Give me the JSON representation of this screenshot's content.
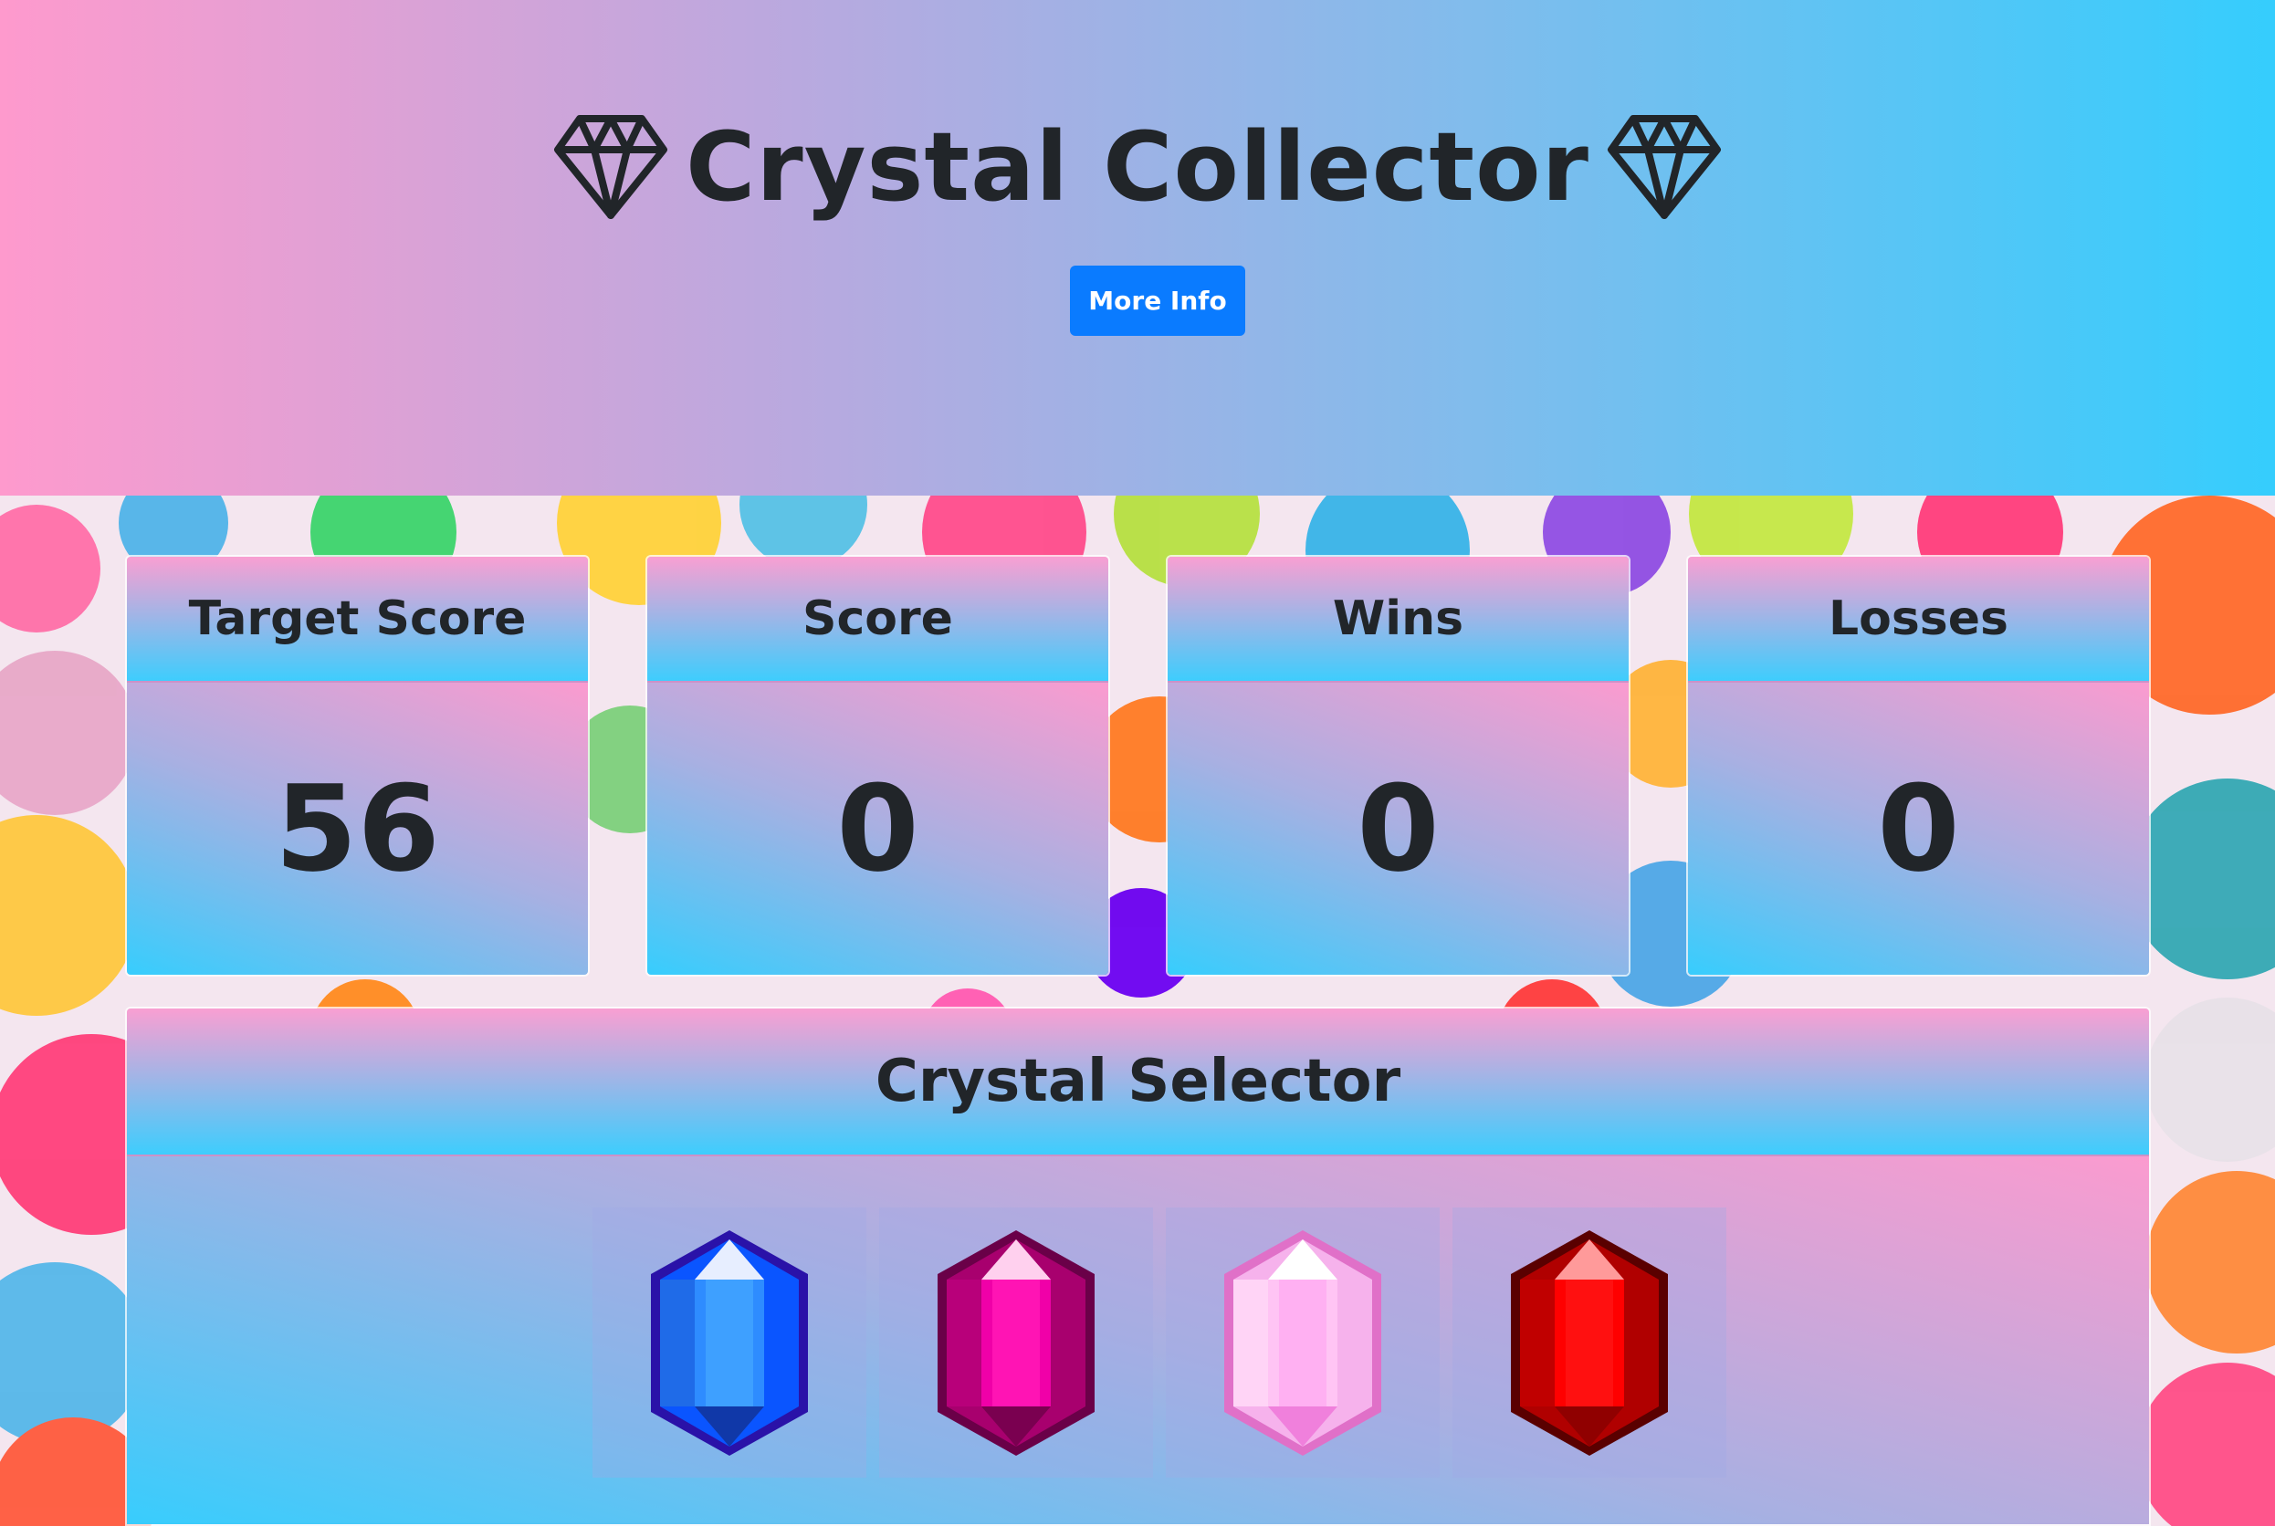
{
  "header": {
    "title": "Crystal Collector",
    "left_icon": "diamond-icon",
    "right_icon": "diamond-icon",
    "more_info_label": "More Info",
    "button_color": "#0a7bff"
  },
  "stats": {
    "target": {
      "label": "Target Score",
      "value": "56"
    },
    "score": {
      "label": "Score",
      "value": "0"
    },
    "wins": {
      "label": "Wins",
      "value": "0"
    },
    "losses": {
      "label": "Losses",
      "value": "0"
    }
  },
  "selector": {
    "title": "Crystal Selector",
    "crystals": [
      {
        "name": "blue-crystal",
        "color": "#1e74ff"
      },
      {
        "name": "magenta-crystal",
        "color": "#f200a6"
      },
      {
        "name": "pink-crystal",
        "color": "#ffb0f2"
      },
      {
        "name": "red-crystal",
        "color": "#ff0000"
      }
    ]
  },
  "colors": {
    "gradient_pink": "#fe9acd",
    "gradient_blue": "#35cdfd",
    "text": "#212529"
  }
}
